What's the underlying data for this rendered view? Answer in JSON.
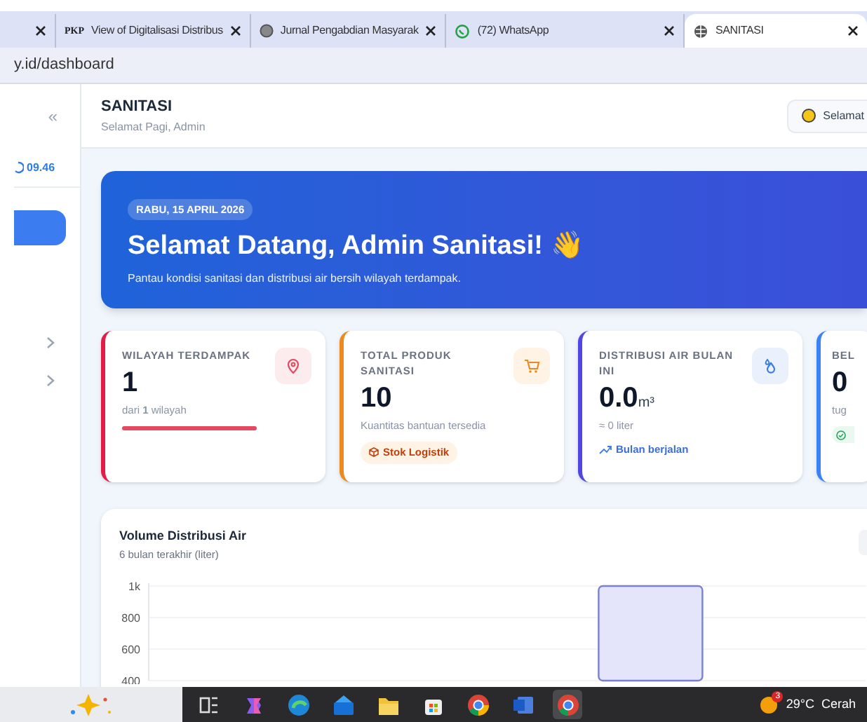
{
  "browser": {
    "tabs": [
      {
        "selected": false
      },
      {
        "label": "View of Digitalisasi Distribus",
        "favicon": "PKP",
        "selected": false
      },
      {
        "label": "Jurnal Pengabdian Masyarak",
        "selected": false
      },
      {
        "label": "(72) WhatsApp",
        "selected": false
      },
      {
        "label": "SANITASI",
        "selected": true
      }
    ],
    "address": "y.id/dashboard"
  },
  "sidebar": {
    "collapse": "«",
    "time": "09.46"
  },
  "header": {
    "title": "SANITASI",
    "subtitle": "Selamat Pagi, Admin",
    "button": "Selamat"
  },
  "hero": {
    "date": "RABU, 15 APRIL 2026",
    "title": "Selamat Datang, Admin Sanitasi! 👋",
    "subtitle": "Pantau kondisi sanitasi dan distribusi air bersih wilayah terdampak."
  },
  "cards": [
    {
      "label": "WILAYAH TERDAMPAK",
      "value": "1",
      "note": "dari **1** wilayah",
      "color": "#e11d48",
      "kind": "progress",
      "level": 1
    },
    {
      "label": "TOTAL PRODUK SANITASI",
      "value": "10",
      "note": "Kuantitas bantuan tersedia",
      "color": "#ea8a1f",
      "kind": "badge",
      "badge": "Stok Logistik"
    },
    {
      "label": "DISTRIBUSI AIR BULAN INI",
      "value": "0.0",
      "unit": "m³",
      "note": "≈ 0 liter",
      "color": "#4f46e5",
      "kind": "trend",
      "trend": "Bulan berjalan"
    },
    {
      "label": "BEL",
      "value": "0",
      "note": "tug",
      "color": "#3b82f6",
      "kind": "check"
    }
  ],
  "chart_panel": {
    "subtitle": "6 bulan terakhir (liter)",
    "chart_data": {
      "type": "bar",
      "title": "Volume Distribusi Air",
      "ylim": [
        400,
        1000
      ],
      "grid": true,
      "yticks": [
        {
          "value": 400,
          "label": "400"
        },
        {
          "value": 600,
          "label": "600"
        },
        {
          "value": 800,
          "label": "800"
        },
        {
          "value": 1000,
          "label": "1k"
        }
      ],
      "values": [
        null,
        null,
        null,
        1000,
        null
      ]
    }
  },
  "taskbar": {
    "weather": "29°C",
    "condition": "Cerah",
    "badge": "3"
  }
}
